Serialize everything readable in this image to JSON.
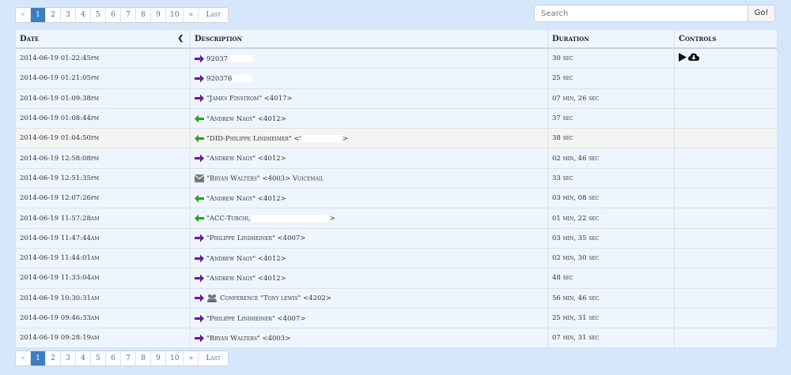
{
  "pagination": {
    "prev": "«",
    "pages": [
      "1",
      "2",
      "3",
      "4",
      "5",
      "6",
      "7",
      "8",
      "9",
      "10"
    ],
    "active": "1",
    "next": "»",
    "last": "Last"
  },
  "search": {
    "placeholder": "Search",
    "button": "Go!"
  },
  "table": {
    "headers": [
      "Date",
      "Description",
      "Duration",
      "Controls"
    ],
    "rows": [
      {
        "date": "2014-06-19 01:22:45pm",
        "dir": "out",
        "desc": "92037",
        "desc_tail": "",
        "redact": 30,
        "duration": "30 sec",
        "controls": true
      },
      {
        "date": "2014-06-19 01:21:05pm",
        "dir": "out",
        "desc": "920376",
        "desc_tail": "",
        "redact": 24,
        "duration": "25 sec"
      },
      {
        "date": "2014-06-19 01:09:38pm",
        "dir": "out",
        "desc": "\"James Finstrom\" <4017>",
        "desc_tail": "",
        "redact": 0,
        "duration": "07 min, 26 sec"
      },
      {
        "date": "2014-06-19 01:08:44pm",
        "dir": "in",
        "desc": "\"Andrew Nagy\" <4012>",
        "desc_tail": "",
        "redact": 0,
        "duration": "37 sec"
      },
      {
        "date": "2014-06-19 01:04:50pm",
        "dir": "in",
        "desc": "\"DID-Philippe Lindheimer\" <'",
        "desc_tail": ">",
        "redact": 50,
        "duration": "38 sec",
        "hl": true
      },
      {
        "date": "2014-06-19 12:58:08pm",
        "dir": "out",
        "desc": "\"Andrew Nagy\" <4012>",
        "desc_tail": "",
        "redact": 0,
        "duration": "02 min, 46 sec"
      },
      {
        "date": "2014-06-19 12:51:35pm",
        "dir": "vm",
        "desc": "\"Bryan Walters\" <4003> Voicemail",
        "desc_tail": "",
        "redact": 0,
        "duration": "33 sec"
      },
      {
        "date": "2014-06-19 12:07:26pm",
        "dir": "in",
        "desc": "\"Andrew Nagy\" <4012>",
        "desc_tail": "",
        "redact": 0,
        "duration": "03 min, 08 sec"
      },
      {
        "date": "2014-06-19 11:57:28am",
        "dir": "in",
        "desc": "\"ACC-Turchi,",
        "desc_tail": ">",
        "redact": 98,
        "duration": "01 min, 22 sec"
      },
      {
        "date": "2014-06-19 11:47:44am",
        "dir": "out",
        "desc": "\"Philippe Lindheiner\" <4007>",
        "desc_tail": "",
        "redact": 0,
        "duration": "03 min, 35 sec"
      },
      {
        "date": "2014-06-19 11:44:01am",
        "dir": "out",
        "desc": "\"Andrew Nagy\" <4012>",
        "desc_tail": "",
        "redact": 0,
        "duration": "02 min, 30 sec"
      },
      {
        "date": "2014-06-19 11:33:04am",
        "dir": "out",
        "desc": "\"Andrew Nagy\" <4012>",
        "desc_tail": "",
        "redact": 0,
        "duration": "48 sec"
      },
      {
        "date": "2014-06-19 10:30:31am",
        "dir": "conf",
        "desc": "Conference \"Tony lewis\" <4202>",
        "desc_tail": "",
        "redact": 0,
        "duration": "56 min, 46 sec"
      },
      {
        "date": "2014-06-19 09:46:33am",
        "dir": "out",
        "desc": "\"Philippe Lindheiner\" <4007>",
        "desc_tail": "",
        "redact": 0,
        "duration": "25 min, 31 sec"
      },
      {
        "date": "2014-06-19 09:28:19am",
        "dir": "out",
        "desc": "\"Bryan Walters\" <4003>",
        "desc_tail": "",
        "redact": 0,
        "duration": "07 min, 31 sec"
      }
    ]
  },
  "icons": {
    "outbound": "arrow-right-icon",
    "inbound": "arrow-left-icon",
    "voicemail": "envelope-icon",
    "conference": "users-icon",
    "play": "play-icon",
    "download": "cloud-download-icon"
  },
  "colors": {
    "outbound": "#6a1b9a",
    "inbound": "#1fa51f",
    "voicemail": "#777777",
    "active_page": "#3c7ec0"
  }
}
